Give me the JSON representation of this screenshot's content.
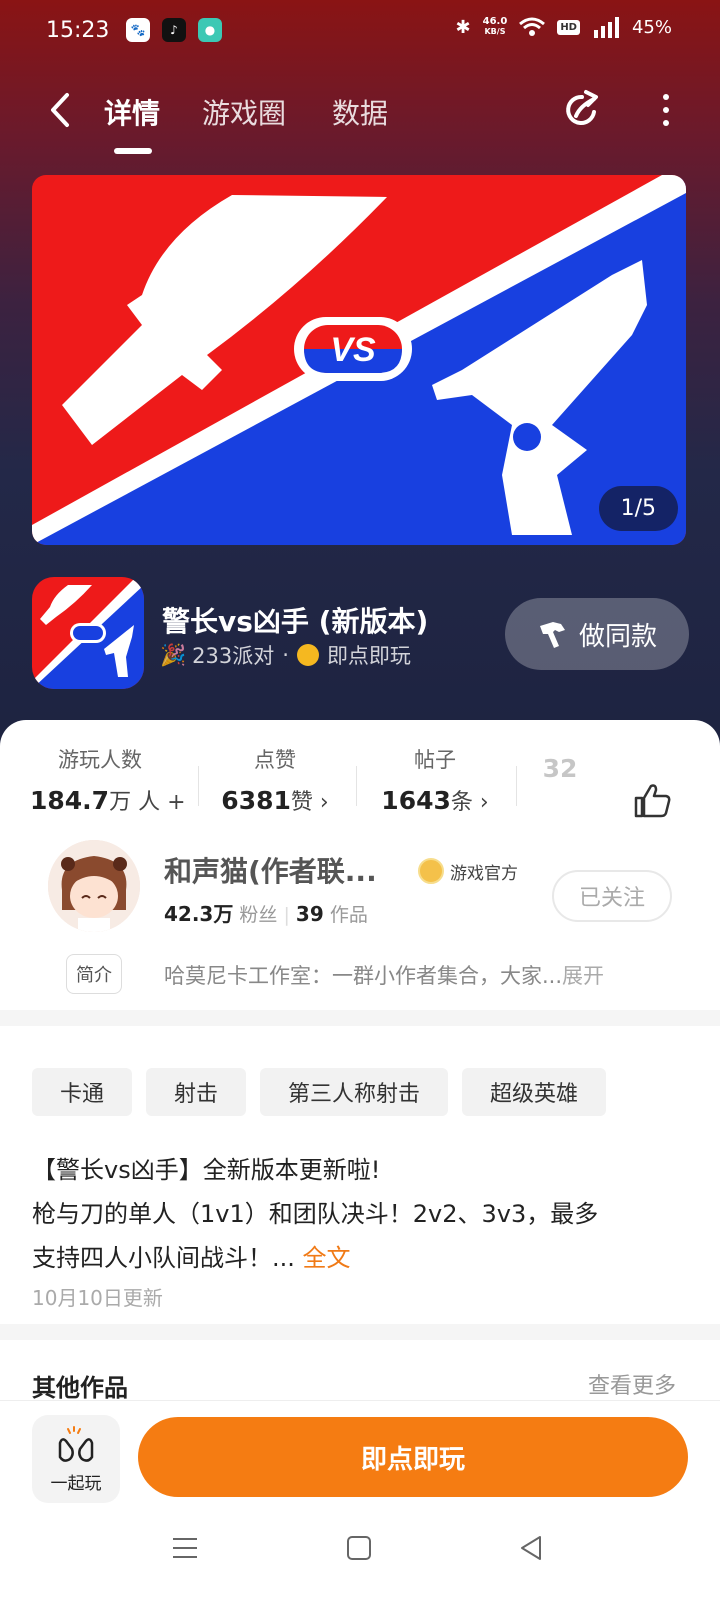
{
  "status_bar": {
    "time": "15:23",
    "net_speed_value": "46.0",
    "net_speed_unit": "KB/S",
    "hd": "HD",
    "signal": "4G",
    "battery": "45%"
  },
  "nav": {
    "tabs": [
      {
        "label": "详情",
        "active": true
      },
      {
        "label": "游戏圈",
        "active": false
      },
      {
        "label": "数据",
        "active": false
      }
    ]
  },
  "banner": {
    "counter": "1/5",
    "vs_text": "VS",
    "colors": {
      "red": "#ee1a1a",
      "blue": "#1840e0"
    }
  },
  "game": {
    "title": "警长vs凶手 (新版本)",
    "party": "233派对",
    "play_mode": "即点即玩",
    "copy_button": "做同款"
  },
  "stats": [
    {
      "label": "游玩人数",
      "value": "184.7",
      "unit": "万 人 +"
    },
    {
      "label": "点赞",
      "value": "6381",
      "unit": "赞 ›"
    },
    {
      "label": "帖子",
      "value": "1643",
      "unit": "条 ›"
    },
    {
      "label": "",
      "value": "32",
      "unit": ""
    }
  ],
  "author": {
    "name": "和声猫(作者联...",
    "badge": "游戏官方",
    "fans_value": "42.3万",
    "fans_label": "粉丝",
    "works_value": "39",
    "works_label": "作品",
    "follow_button": "已关注",
    "intro_tag": "简介",
    "intro_text": "哈莫尼卡工作室：一群小作者集合，大家...",
    "intro_more": "展开"
  },
  "tags": [
    "卡通",
    "射击",
    "第三人称射击",
    "超级英雄"
  ],
  "description": {
    "line1": "【警长vs凶手】全新版本更新啦!",
    "line2": "枪与刀的单人（1v1）和团队决斗！2v2、3v3，最多",
    "line3": "支持四人小队间战斗！... ",
    "full_link": "全文",
    "updated": "10月10日更新"
  },
  "other_section": {
    "title": "其他作品",
    "more": "查看更多"
  },
  "bottom": {
    "together_label": "一起玩",
    "play_button": "即点即玩"
  },
  "accent_color": "#f57c12"
}
